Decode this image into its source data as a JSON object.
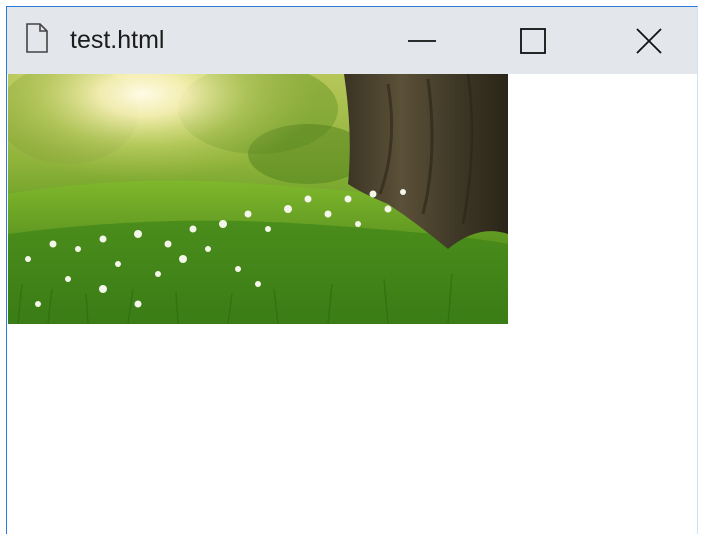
{
  "window": {
    "title": "test.html",
    "icons": {
      "document": "document-icon",
      "minimize": "minimize-icon",
      "maximize": "maximize-icon",
      "close": "close-icon"
    }
  },
  "content": {
    "image": {
      "subject": "meadow-with-tree"
    }
  }
}
